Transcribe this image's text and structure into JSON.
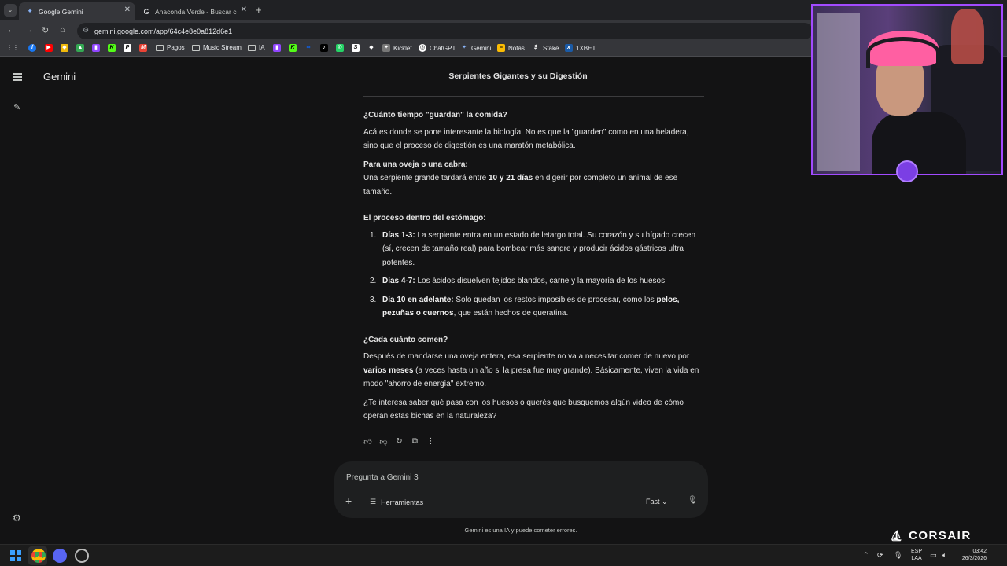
{
  "browser": {
    "tabs": [
      {
        "title": "Google Gemini",
        "active": true
      },
      {
        "title": "Anaconda Verde - Buscar con G",
        "active": false
      }
    ],
    "url": "gemini.google.com/app/64c4e8e0a812d6e1",
    "bookmarks": [
      {
        "label": "",
        "icon": "facebook-icon",
        "color": "#1877f2"
      },
      {
        "label": "",
        "icon": "youtube-icon",
        "color": "#ff0000"
      },
      {
        "label": "",
        "icon": "binance-icon",
        "color": "#f0b90b"
      },
      {
        "label": "",
        "icon": "twitch-icon",
        "color": "#9146ff"
      },
      {
        "label": "",
        "icon": "kick-icon",
        "color": "#53fc18"
      },
      {
        "label": "",
        "icon": "patreon-icon",
        "color": "#ffffff"
      },
      {
        "label": "",
        "icon": "gmail-icon",
        "color": "#ea4335"
      },
      {
        "label": "Pagos",
        "icon": "folder-icon"
      },
      {
        "label": "Music Stream",
        "icon": "folder-icon"
      },
      {
        "label": "IA",
        "icon": "folder-icon"
      },
      {
        "label": "",
        "icon": "twitch-icon",
        "color": "#9146ff"
      },
      {
        "label": "",
        "icon": "kick-icon",
        "color": "#53fc18"
      },
      {
        "label": "",
        "icon": "meta-icon",
        "color": "#0866ff"
      },
      {
        "label": "",
        "icon": "tiktok-icon",
        "color": "#000000"
      },
      {
        "label": "",
        "icon": "whatsapp-icon",
        "color": "#25d366"
      },
      {
        "label": "",
        "icon": "stripe-icon",
        "color": "#ffffff"
      },
      {
        "label": "Kicklet",
        "icon": "kicklet-icon",
        "color": "#ffffff"
      },
      {
        "label": "ChatGPT",
        "icon": "chatgpt-icon",
        "color": "#ffffff"
      },
      {
        "label": "Gemini",
        "icon": "gemini-icon",
        "color": "#8ab4f8"
      },
      {
        "label": "Notas",
        "icon": "notes-icon",
        "color": "#fbbc04"
      },
      {
        "label": "Stake",
        "icon": "stake-icon",
        "color": "#ffffff"
      },
      {
        "label": "1XBET",
        "icon": "1xbet-icon",
        "color": "#1a5aa6"
      }
    ]
  },
  "app": {
    "brand": "Gemini",
    "chat_title": "Serpientes Gigantes y su Digestión",
    "input_placeholder": "Pregunta a Gemini 3",
    "tools_label": "Herramientas",
    "model_label": "Fast",
    "disclaimer": "Gemini es una IA y puede cometer errores."
  },
  "response": {
    "h1": "¿Cuánto tiempo \"guardan\" la comida?",
    "p1": "Acá es donde se pone interesante la biología. No es que la \"guarden\" como en una heladera, sino que el proceso de digestión es una maratón metabólica.",
    "h2": "Para una oveja o una cabra:",
    "p2_a": "Una serpiente grande tardará entre ",
    "p2_b": "10 y 21 días",
    "p2_c": " en digerir por completo un animal de ese tamaño.",
    "h3": "El proceso dentro del estómago:",
    "steps": [
      {
        "num": "1.",
        "label": "Días 1-3:",
        "text": " La serpiente entra en un estado de letargo total. Su corazón y su hígado crecen (sí, crecen de tamaño real) para bombear más sangre y producir ácidos gástricos ultra potentes."
      },
      {
        "num": "2.",
        "label": "Días 4-7:",
        "text": " Los ácidos disuelven tejidos blandos, carne y la mayoría de los huesos."
      },
      {
        "num": "3.",
        "label": "Día 10 en adelante:",
        "text": " Solo quedan los restos imposibles de procesar, como los ",
        "bold2": "pelos, pezuñas o cuernos",
        "text2": ", que están hechos de queratina."
      }
    ],
    "h4": "¿Cada cuánto comen?",
    "p4_a": "Después de mandarse una oveja entera, esa serpiente no va a necesitar comer de nuevo por ",
    "p4_b": "varios meses",
    "p4_c": " (a veces hasta un año si la presa fue muy grande). Básicamente, viven la vida en modo \"ahorro de energía\" extremo.",
    "p5": "¿Te interesa saber qué pasa con los huesos o querés que busquemos algún video de cómo operan estas bichas en la naturaleza?"
  },
  "overlay": {
    "sponsor": "CORSAIR"
  },
  "taskbar": {
    "lang_top": "ESP",
    "lang_bottom": "LAA",
    "time": "03:42",
    "date": "26/3/2026"
  }
}
